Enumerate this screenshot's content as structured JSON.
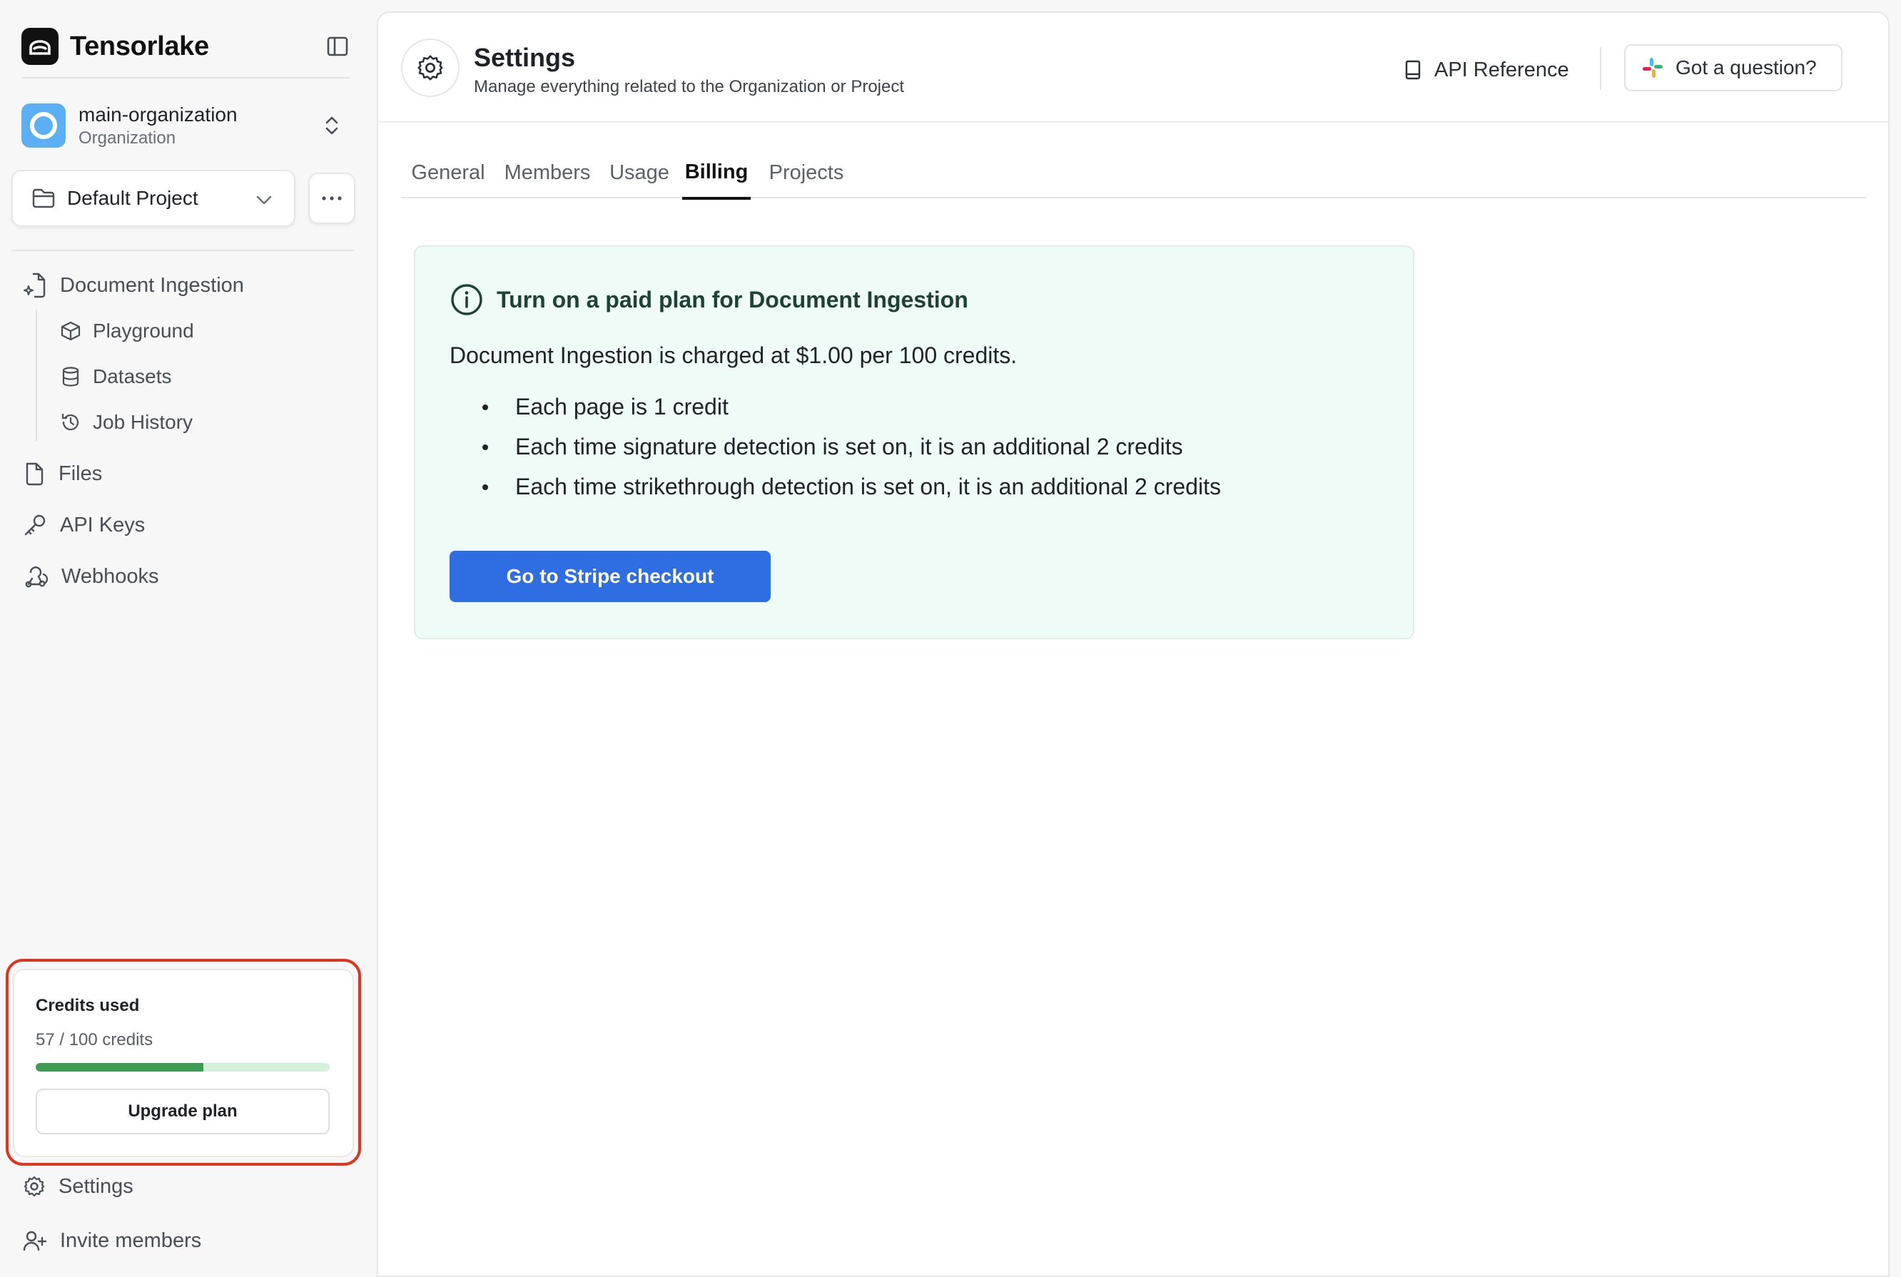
{
  "app": {
    "name": "Tensorlake",
    "organization": {
      "name": "main-organization",
      "role": "Organization"
    },
    "project_selector": {
      "value": "Default Project"
    }
  },
  "sidebar": {
    "nav": [
      {
        "label": "Document Ingestion",
        "icon": "document-sparkle-icon"
      },
      {
        "label": "Files",
        "icon": "file-icon"
      },
      {
        "label": "API Keys",
        "icon": "key-icon"
      },
      {
        "label": "Webhooks",
        "icon": "webhook-icon"
      }
    ],
    "subnav": [
      {
        "label": "Playground",
        "icon": "cube-icon"
      },
      {
        "label": "Datasets",
        "icon": "database-icon"
      },
      {
        "label": "Job History",
        "icon": "history-icon"
      }
    ],
    "credits": {
      "title": "Credits used",
      "count_text": "57 / 100 credits",
      "used_fraction": 0.57,
      "upgrade_label": "Upgrade plan",
      "highlight_color": "#e0341f"
    },
    "footer": [
      {
        "label": "Settings",
        "icon": "gear-icon"
      },
      {
        "label": "Invite members",
        "icon": "user-plus-icon"
      }
    ]
  },
  "header": {
    "title": "Settings",
    "subtitle": "Manage everything related to the Organization or Project",
    "api_reference": "API Reference",
    "question": "Got a question?"
  },
  "tabs": [
    {
      "label": "General",
      "active": false
    },
    {
      "label": "Members",
      "active": false
    },
    {
      "label": "Usage",
      "active": false
    },
    {
      "label": "Billing",
      "active": true
    },
    {
      "label": "Projects",
      "active": false
    }
  ],
  "billing": {
    "notice_title": "Turn on a paid plan for Document Ingestion",
    "description": "Document Ingestion is charged at $1.00 per 100 credits.",
    "bullets": [
      "Each page is 1 credit",
      "Each time signature detection is set on, it is an additional 2 credits",
      "Each time strikethrough detection is set on, it is an additional 2 credits"
    ],
    "checkout_label": "Go to Stripe checkout",
    "accent_color": "#2f6de3"
  }
}
